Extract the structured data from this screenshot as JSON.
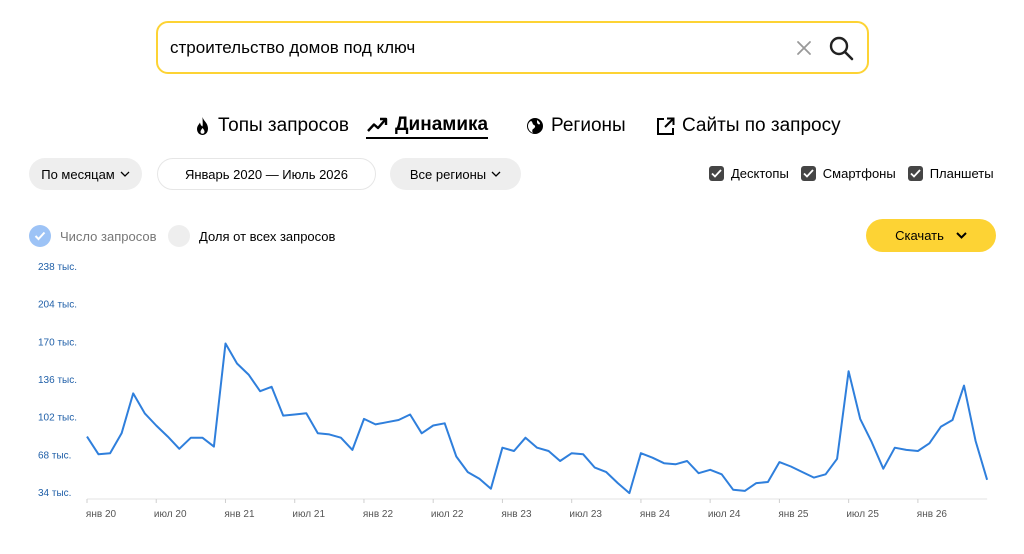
{
  "search": {
    "value": "строительство домов под ключ",
    "clear_icon": "close-icon",
    "search_icon": "search-icon"
  },
  "tabs": [
    {
      "label": "Топы запросов",
      "icon": "fire-icon",
      "active": false
    },
    {
      "label": "Динамика",
      "icon": "trend-up-icon",
      "active": true
    },
    {
      "label": "Регионы",
      "icon": "globe-icon",
      "active": false
    },
    {
      "label": "Сайты по запросу",
      "icon": "external-link-icon",
      "active": false
    }
  ],
  "controls": {
    "period_group": "По месяцам",
    "date_range": "Январь 2020 — Июль 2026",
    "regions": "Все регионы"
  },
  "devices": [
    {
      "label": "Десктопы",
      "checked": true
    },
    {
      "label": "Смартфоны",
      "checked": true
    },
    {
      "label": "Планшеты",
      "checked": true
    }
  ],
  "metrics": {
    "count": {
      "label": "Число запросов",
      "selected": true
    },
    "share": {
      "label": "Доля от всех запросов",
      "selected": false
    }
  },
  "download": {
    "label": "Скачать"
  },
  "colors": {
    "accent_yellow": "#fdd334",
    "line_blue": "#2f7fdc",
    "axis_label_blue": "#1f5fa8",
    "radio_on": "#9dc3f6"
  },
  "chart_data": {
    "type": "line",
    "y_ticks": [
      {
        "value": 34,
        "label": "34 тыс."
      },
      {
        "value": 68,
        "label": "68 тыс."
      },
      {
        "value": 102,
        "label": "102 тыс."
      },
      {
        "value": 136,
        "label": "136 тыс."
      },
      {
        "value": 170,
        "label": "170 тыс."
      },
      {
        "value": 204,
        "label": "204 тыс."
      },
      {
        "value": 238,
        "label": "238 тыс."
      }
    ],
    "ylim": [
      34,
      238
    ],
    "x_ticks": [
      {
        "index": 0,
        "label": "янв 20"
      },
      {
        "index": 6,
        "label": "июл 20"
      },
      {
        "index": 12,
        "label": "янв 21"
      },
      {
        "index": 18,
        "label": "июл 21"
      },
      {
        "index": 24,
        "label": "янв 22"
      },
      {
        "index": 30,
        "label": "июл 22"
      },
      {
        "index": 36,
        "label": "янв 23"
      },
      {
        "index": 42,
        "label": "июл 23"
      },
      {
        "index": 48,
        "label": "янв 24"
      },
      {
        "index": 54,
        "label": "июл 24"
      },
      {
        "index": 60,
        "label": "янв 25"
      },
      {
        "index": 66,
        "label": "июл 25"
      },
      {
        "index": 72,
        "label": "янв 26"
      }
    ],
    "grid": false,
    "series": [
      {
        "values": [
          84,
          68,
          69,
          87,
          123,
          105,
          94,
          84,
          73,
          83,
          83,
          75,
          168,
          150,
          140,
          125,
          129,
          103,
          104,
          105,
          87,
          86,
          83,
          72,
          100,
          95,
          97,
          99,
          104,
          87,
          94,
          96,
          66,
          52,
          46,
          37,
          74,
          71,
          83,
          74,
          71,
          62,
          69,
          68,
          56,
          52,
          42,
          33,
          69,
          65,
          60,
          59,
          62,
          51,
          54,
          50,
          36,
          35,
          42,
          43,
          61,
          57,
          52,
          47,
          50,
          64,
          143,
          100,
          79,
          55,
          74,
          72,
          71,
          78,
          93,
          99,
          130,
          80,
          45
        ]
      }
    ]
  }
}
